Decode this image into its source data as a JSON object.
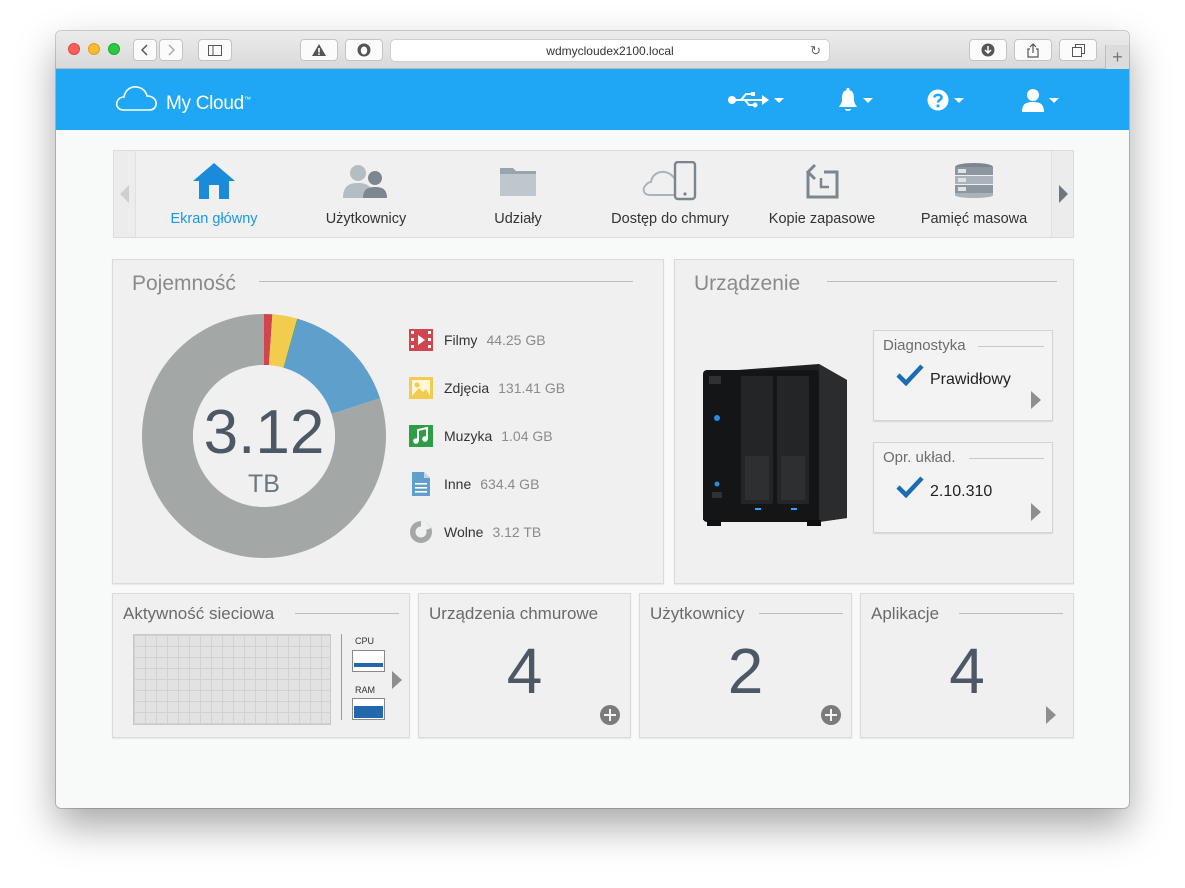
{
  "browser": {
    "url": "wdmycloudex2100.local"
  },
  "app": {
    "logo_text": "My Cloud",
    "logo_tm": "™"
  },
  "header_icons": [
    "usb-icon",
    "bell-icon",
    "help-icon",
    "user-icon"
  ],
  "nav": {
    "items": [
      {
        "label": "Ekran główny",
        "icon": "home-icon",
        "active": true
      },
      {
        "label": "Użytkownicy",
        "icon": "users-icon"
      },
      {
        "label": "Udziały",
        "icon": "folder-icon"
      },
      {
        "label": "Dostęp do chmury",
        "icon": "cloud-device-icon"
      },
      {
        "label": "Kopie zapasowe",
        "icon": "backup-icon"
      },
      {
        "label": "Pamięć masowa",
        "icon": "storage-icon"
      }
    ]
  },
  "capacity": {
    "title": "Pojemność",
    "total_value": "3.12",
    "total_unit": "TB",
    "legend": [
      {
        "label": "Filmy",
        "value": "44.25 GB",
        "color": "#d0454e",
        "icon": "film-icon"
      },
      {
        "label": "Zdjęcia",
        "value": "131.41 GB",
        "color": "#f2cc4f",
        "icon": "photo-icon"
      },
      {
        "label": "Muzyka",
        "value": "1.04 GB",
        "color": "#2e9e46",
        "icon": "music-icon"
      },
      {
        "label": "Inne",
        "value": "634.4 GB",
        "color": "#5e9fcc",
        "icon": "document-icon"
      },
      {
        "label": "Wolne",
        "value": "3.12 TB",
        "color": "#a3a8a6",
        "icon": "pie-icon"
      }
    ],
    "donut_fractions": {
      "filmy": 0.011,
      "zdjecia": 0.033,
      "muzyka": 0.001,
      "inne": 0.155,
      "wolne": 0.8
    }
  },
  "device": {
    "title": "Urządzenie",
    "diagnostics": {
      "title": "Diagnostyka",
      "value": "Prawidłowy"
    },
    "firmware": {
      "title": "Opr. układ.",
      "value": "2.10.310"
    }
  },
  "network": {
    "title": "Aktywność sieciowa",
    "cpu_label": "CPU",
    "ram_label": "RAM"
  },
  "cards": {
    "cloud_devices": {
      "title": "Urządzenia chmurowe",
      "count": "4"
    },
    "users": {
      "title": "Użytkownicy",
      "count": "2"
    },
    "apps": {
      "title": "Aplikacje",
      "count": "4"
    }
  },
  "colors": {
    "header": "#1fa7f5",
    "accent": "#1a97e6",
    "check": "#1a6cb3",
    "number": "#4d5866"
  }
}
